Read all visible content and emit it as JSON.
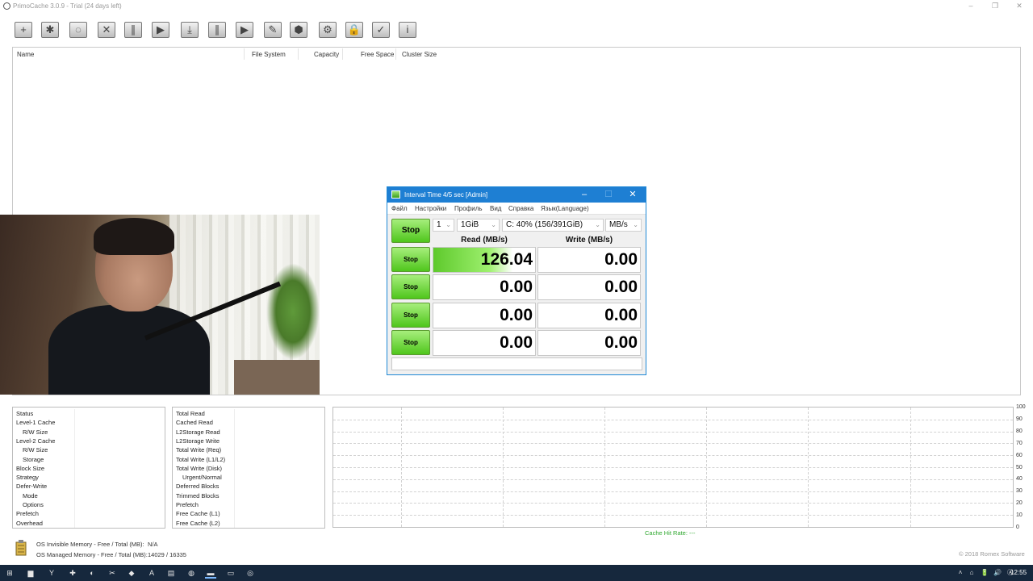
{
  "window": {
    "title": "PrimoCache 3.0.9 - Trial (24 days left)",
    "controls": {
      "minimize": "–",
      "restore": "❐",
      "close": "✕"
    }
  },
  "toolbar": {
    "buttons": [
      {
        "name": "new-cache-task",
        "glyph": "+"
      },
      {
        "name": "configure",
        "glyph": "✱"
      },
      {
        "name": "check",
        "glyph": "◌"
      },
      {
        "name": "remove",
        "glyph": "✕"
      },
      {
        "name": "pause",
        "glyph": "∥"
      },
      {
        "name": "resume",
        "glyph": "▶"
      },
      {
        "name": "flush",
        "glyph": "⤓"
      },
      {
        "name": "pause-all",
        "glyph": "∥"
      },
      {
        "name": "resume-all",
        "glyph": "▶"
      },
      {
        "name": "erase",
        "glyph": "✎"
      },
      {
        "name": "eraser",
        "glyph": "⬢"
      },
      {
        "name": "settings",
        "glyph": "⚙"
      },
      {
        "name": "license",
        "glyph": "🔒"
      },
      {
        "name": "help-book",
        "glyph": "✓"
      },
      {
        "name": "info",
        "glyph": "i"
      }
    ]
  },
  "disk_list": {
    "columns": [
      "Name",
      "File System",
      "Capacity",
      "Free Space",
      "Cluster Size"
    ]
  },
  "bench": {
    "title": "Interval Time 4/5 sec [Admin]",
    "controls": {
      "minimize": "–",
      "maximize": "☐",
      "close": "✕"
    },
    "menu": [
      "Файл",
      "Настройки",
      "Профиль",
      "Вид",
      "Справка",
      "Язык(Language)"
    ],
    "main_button": "Stop",
    "count": "1",
    "size": "1GiB",
    "drive": "C: 40% (156/391GiB)",
    "unit": "MB/s",
    "read_header": "Read (MB/s)",
    "write_header": "Write (MB/s)",
    "row_button": "Stop",
    "rows": [
      {
        "read": "126.04",
        "write": "0.00"
      },
      {
        "read": "0.00",
        "write": "0.00"
      },
      {
        "read": "0.00",
        "write": "0.00"
      },
      {
        "read": "0.00",
        "write": "0.00"
      }
    ]
  },
  "status_panel": {
    "rows": [
      {
        "label": "Status",
        "indent": false
      },
      {
        "label": "Level-1 Cache",
        "indent": false
      },
      {
        "label": "R/W Size",
        "indent": true
      },
      {
        "label": "Level-2 Cache",
        "indent": false
      },
      {
        "label": "R/W Size",
        "indent": true
      },
      {
        "label": "Storage",
        "indent": true
      },
      {
        "label": "Block Size",
        "indent": false
      },
      {
        "label": "Strategy",
        "indent": false
      },
      {
        "label": "Defer-Write",
        "indent": false
      },
      {
        "label": "Mode",
        "indent": true
      },
      {
        "label": "Options",
        "indent": true
      },
      {
        "label": "Prefetch",
        "indent": false
      },
      {
        "label": "Overhead",
        "indent": false
      }
    ]
  },
  "stats_panel": {
    "rows": [
      {
        "label": "Total Read",
        "indent": false
      },
      {
        "label": "Cached Read",
        "indent": false
      },
      {
        "label": "L2Storage Read",
        "indent": false
      },
      {
        "label": "L2Storage Write",
        "indent": false
      },
      {
        "label": "Total Write (Req)",
        "indent": false
      },
      {
        "label": "Total Write (L1/L2)",
        "indent": false
      },
      {
        "label": "Total Write (Disk)",
        "indent": false
      },
      {
        "label": "Urgent/Normal",
        "indent": true
      },
      {
        "label": "Deferred Blocks",
        "indent": false
      },
      {
        "label": "Trimmed Blocks",
        "indent": false
      },
      {
        "label": "Prefetch",
        "indent": false
      },
      {
        "label": "Free Cache (L1)",
        "indent": false
      },
      {
        "label": "Free Cache (L2)",
        "indent": false
      }
    ]
  },
  "graph": {
    "y_labels": [
      "100",
      "90",
      "80",
      "70",
      "60",
      "50",
      "40",
      "30",
      "20",
      "10",
      "0"
    ],
    "hit_rate_label": "Cache Hit Rate: ---"
  },
  "memory": {
    "invisible_label": "OS Invisible Memory - Free / Total (MB):",
    "invisible_value": "N/A",
    "managed_label": "OS Managed Memory - Free / Total (MB):",
    "managed_value": "14029 / 16335"
  },
  "copyright": "© 2018 Romex Software",
  "taskbar": {
    "apps": [
      {
        "name": "start-icon",
        "glyph": "⊞"
      },
      {
        "name": "file-explorer-icon",
        "glyph": "▆"
      },
      {
        "name": "browser-yandex-icon",
        "glyph": "Y"
      },
      {
        "name": "app-flag-icon",
        "glyph": "✚"
      },
      {
        "name": "steam-icon",
        "glyph": "◐"
      },
      {
        "name": "app-twin-icon",
        "glyph": "✂"
      },
      {
        "name": "game-icon",
        "glyph": "◆"
      },
      {
        "name": "app-a-icon",
        "glyph": "A"
      },
      {
        "name": "app-blue-icon",
        "glyph": "▤"
      },
      {
        "name": "primocache-task-icon",
        "glyph": "◍"
      },
      {
        "name": "bench-task-icon",
        "glyph": "▬"
      },
      {
        "name": "window-task-icon",
        "glyph": "▭"
      },
      {
        "name": "obs-icon",
        "glyph": "◎"
      }
    ],
    "tray": [
      "˄",
      "⌂",
      "🔋",
      "🔊",
      "Ⓐ",
      "▤"
    ],
    "clock": "12:55"
  }
}
